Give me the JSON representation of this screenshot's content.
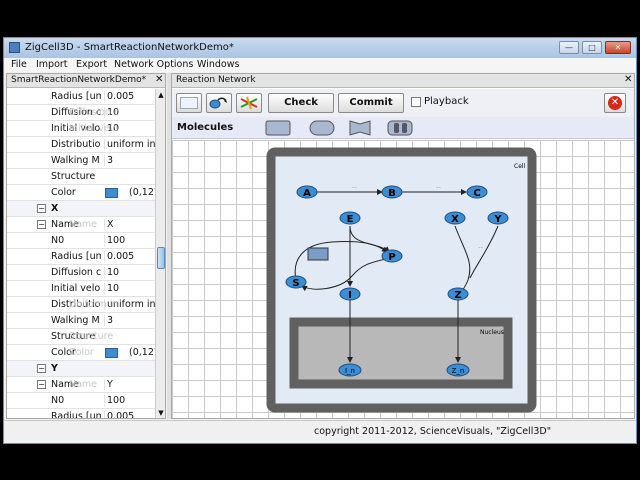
{
  "window": {
    "title": "ZigCell3D - SmartReactionNetworkDemo*"
  },
  "menu": [
    "File",
    "Import",
    "Export",
    "Network Options",
    "Windows"
  ],
  "left_panel": {
    "title": "SmartReactionNetworkDemo*",
    "rows": [
      {
        "kind": "prop",
        "name": "Radius [um",
        "value": "0.005"
      },
      {
        "kind": "prop",
        "name": "Diffusion c",
        "value": "10"
      },
      {
        "kind": "prop",
        "name": "Initial velo",
        "value": "10"
      },
      {
        "kind": "prop",
        "name": "Distribution",
        "value": "uniform in"
      },
      {
        "kind": "prop",
        "name": "Walking M",
        "value": "3"
      },
      {
        "kind": "prop",
        "name": "Structure",
        "value": ""
      },
      {
        "kind": "color",
        "name": "Color",
        "value": "(0,127,"
      },
      {
        "kind": "cat",
        "name": "X"
      },
      {
        "kind": "prop",
        "name": "Name",
        "value": "X"
      },
      {
        "kind": "prop",
        "name": "N0",
        "value": "100"
      },
      {
        "kind": "prop",
        "name": "Radius [um",
        "value": "0.005"
      },
      {
        "kind": "prop",
        "name": "Diffusion c",
        "value": "10"
      },
      {
        "kind": "prop",
        "name": "Initial velo",
        "value": "10"
      },
      {
        "kind": "prop",
        "name": "Distribution",
        "value": "uniform in"
      },
      {
        "kind": "prop",
        "name": "Walking M",
        "value": "3"
      },
      {
        "kind": "prop",
        "name": "Structure",
        "value": ""
      },
      {
        "kind": "color",
        "name": "Color",
        "value": "(0,127,"
      },
      {
        "kind": "cat",
        "name": "Y"
      },
      {
        "kind": "prop",
        "name": "Name",
        "value": "Y"
      },
      {
        "kind": "prop",
        "name": "N0",
        "value": "100"
      },
      {
        "kind": "prop",
        "name": "Radius [um",
        "value": "0.005"
      }
    ],
    "ghosts": [
      "Diffusion c",
      "Initial velo",
      "Name",
      "Uniform in",
      "Structure",
      "Color",
      "Name"
    ]
  },
  "right_panel": {
    "title": "Reaction Network",
    "toolbar": {
      "check_label": "Check",
      "commit_label": "Commit",
      "playback_label": "Playback"
    },
    "molecules_label": "Molecules",
    "diagram": {
      "cell_label": "Cell",
      "nucleus_label": "Nucleus",
      "nodes": [
        "A",
        "B",
        "C",
        "E",
        "X",
        "Y",
        "P",
        "S",
        "I",
        "Z",
        "I_n",
        "Z_n"
      ]
    }
  },
  "status": {
    "text": "copyright 2011-2012, ScienceVisuals, \"ZigCell3D\""
  },
  "colors": {
    "node_fill": "#3c8dd4",
    "node_stroke": "#1b4f7e",
    "cell_border": "#606060",
    "cell_bg": "#e2ebf5",
    "nucleus_bg": "#b8b8b8"
  }
}
